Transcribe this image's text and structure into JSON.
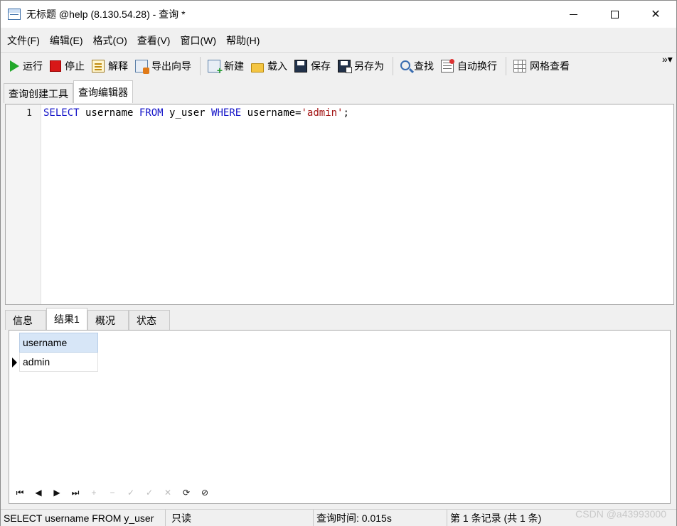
{
  "window": {
    "title": "无标题 @help (8.130.54.28) - 查询 *",
    "controls": {
      "minimize": "",
      "maximize": "",
      "close": "✕"
    }
  },
  "menu": [
    "文件(F)",
    "编辑(E)",
    "格式(O)",
    "查看(V)",
    "窗口(W)",
    "帮助(H)"
  ],
  "toolbar": {
    "run": "运行",
    "stop": "停止",
    "explain": "解释",
    "export_wizard": "导出向导",
    "new": "新建",
    "load": "载入",
    "save": "保存",
    "save_as": "另存为",
    "find": "查找",
    "word_wrap": "自动换行",
    "grid_view": "网格查看",
    "more": "»▾"
  },
  "editor_tabs": [
    "查询创建工具",
    "查询编辑器"
  ],
  "editor": {
    "line_number": "1",
    "tokens": {
      "select": "SELECT",
      "t1": " username ",
      "from": "FROM",
      "t2": " y_user ",
      "where": "WHERE",
      "t3": " username=",
      "str": "'admin'",
      "t4": ";"
    }
  },
  "result_tabs": [
    "信息",
    "结果1",
    "概况",
    "状态"
  ],
  "result_grid": {
    "columns": [
      "username"
    ],
    "rows": [
      [
        "admin"
      ]
    ]
  },
  "nav_buttons": [
    "⏮",
    "◀",
    "▶",
    "⏭",
    "+",
    "−",
    "✓",
    "✓",
    "✕",
    "⟳",
    "⊘"
  ],
  "status": {
    "sql": "SELECT username FROM y_user",
    "readonly": "只读",
    "query_time": "查询时间: 0.015s",
    "records": "第 1 条记录 (共 1 条)"
  },
  "watermark": "CSDN @a43993000"
}
